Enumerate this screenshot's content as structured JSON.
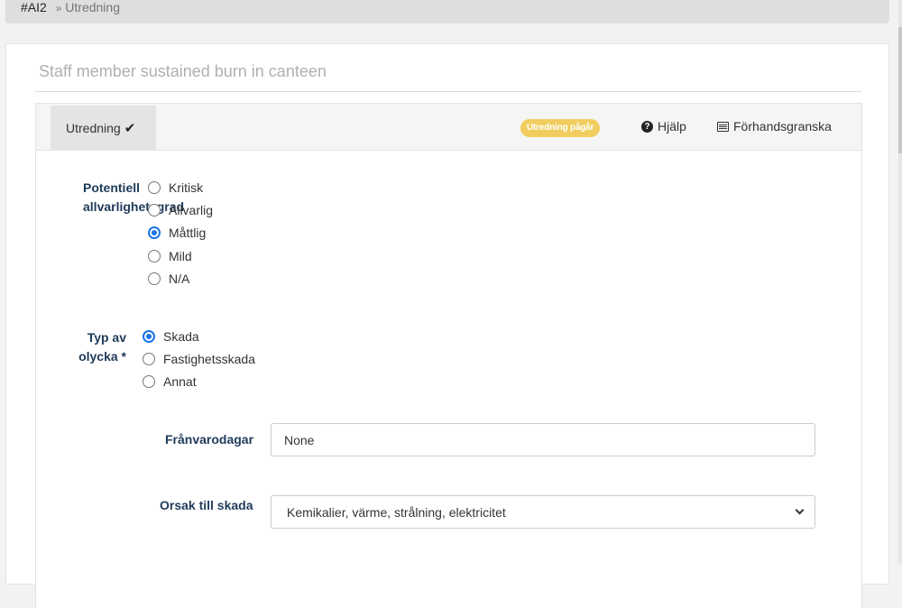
{
  "breadcrumb": {
    "id": "#AI2",
    "separator": "»",
    "current": "Utredning"
  },
  "page": {
    "title": "Staff member sustained burn in canteen"
  },
  "tabs": [
    {
      "label": "Utredning",
      "done": true
    }
  ],
  "status_badge": {
    "label": "Utredning pågår",
    "color": "#f0cd5e"
  },
  "toolbar": {
    "help_label": "Hjälp",
    "preview_label": "Förhandsgranska"
  },
  "severity": {
    "label": "Potentiell allvarlighetsgrad",
    "options": [
      "Kritisk",
      "Allvarlig",
      "Måttlig",
      "Mild",
      "N/A"
    ],
    "selected": "Måttlig"
  },
  "accident_type": {
    "label": "Typ av olycka *",
    "options": [
      "Skada",
      "Fastighetsskada",
      "Annat"
    ],
    "selected": "Skada"
  },
  "absence_days": {
    "label": "Frånvarodagar",
    "value": "None"
  },
  "injury_cause": {
    "label": "Orsak till skada",
    "selected": "Kemikalier, värme, strålning, elektricitet"
  },
  "colors": {
    "accent": "#1a73e8",
    "label_text": "#1f3b5a"
  }
}
